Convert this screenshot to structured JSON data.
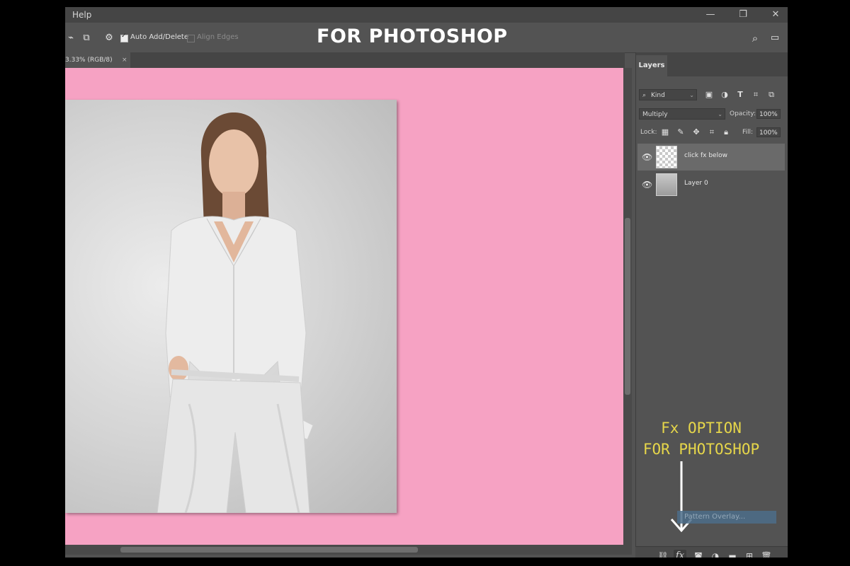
{
  "menubar": {
    "help": "Help"
  },
  "window_controls": {
    "minimize": "—",
    "restore": "❐",
    "close": "✕"
  },
  "options": {
    "auto_add_delete": "Auto Add/Delete",
    "align_edges": "Align Edges",
    "auto_add_checked": true,
    "align_edges_checked": false
  },
  "overlay": {
    "title": "FOR PHOTOSHOP",
    "fx_line1": "Fx OPTION",
    "fx_line2": "FOR PHOTOSHOP"
  },
  "document": {
    "tab_label": "3.33% (RGB/8)",
    "close": "×",
    "canvas_color": "#f6a2c3"
  },
  "layers_panel": {
    "tab": "Layers",
    "filter_kind": "Kind",
    "blend_mode": "Multiply",
    "opacity_label": "Opacity:",
    "opacity_value": "100%",
    "lock_label": "Lock:",
    "fill_label": "Fill:",
    "fill_value": "100%",
    "layers": [
      {
        "name": "click fx below",
        "visible": true,
        "selected": true,
        "thumbnail": "transparent"
      },
      {
        "name": "Layer 0",
        "visible": true,
        "selected": false,
        "thumbnail": "photo"
      }
    ],
    "tooltip": "Pattern Overlay..."
  },
  "icons": {
    "search": "search-icon",
    "workspace": "panel-layout-icon",
    "eye": "eye-icon",
    "fx": "fx-icon"
  },
  "bottom_bar": {
    "fx_label": "fx"
  }
}
